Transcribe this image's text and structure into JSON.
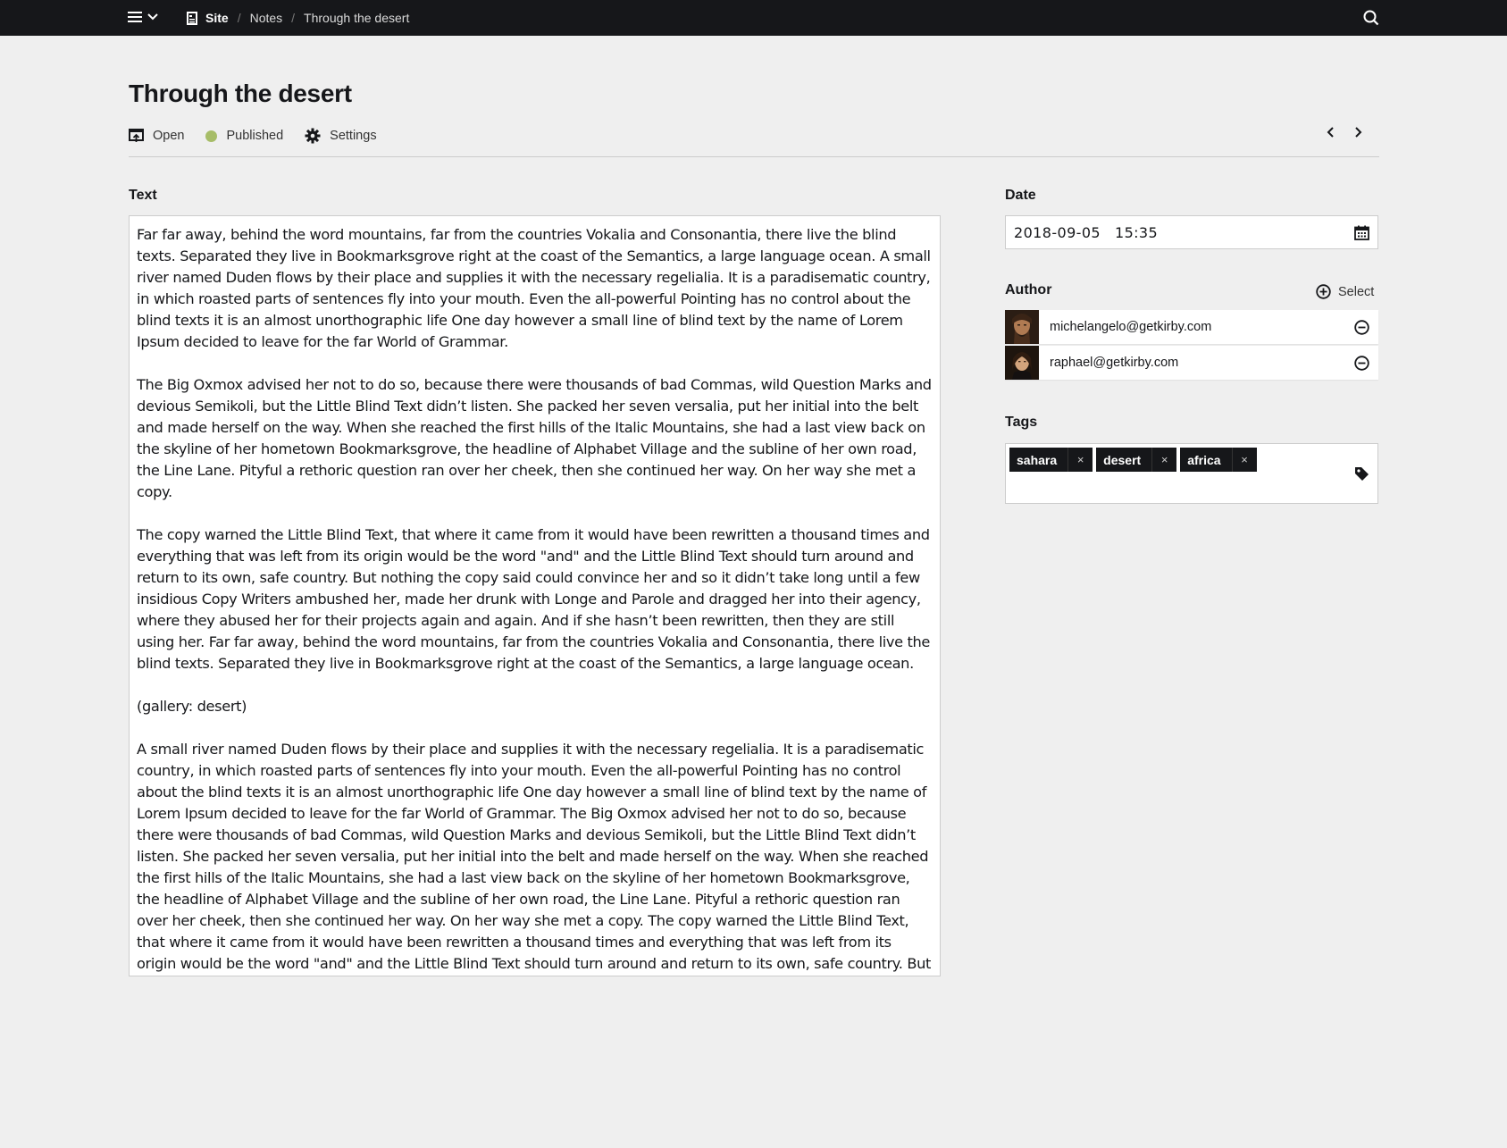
{
  "topbar": {
    "breadcrumb": {
      "site": "Site",
      "items": [
        "Notes",
        "Through the desert"
      ]
    },
    "colors": {
      "background": "#16171a"
    },
    "icons": [
      "hamburger-menu-icon",
      "chevron-down-icon",
      "page-icon",
      "search-icon"
    ]
  },
  "header": {
    "title": "Through the desert",
    "options": {
      "open": "Open",
      "status": "Published",
      "settings": "Settings"
    },
    "status_color": "#a7bd68"
  },
  "fields": {
    "text": {
      "label": "Text",
      "value": "Far far away, behind the word mountains, far from the countries Vokalia and Consonantia, there live the blind texts. Separated they live in Bookmarksgrove right at the coast of the Semantics, a large language ocean. A small river named Duden flows by their place and supplies it with the necessary regelialia. It is a paradisematic country, in which roasted parts of sentences fly into your mouth. Even the all-powerful Pointing has no control about the blind texts it is an almost unorthographic life One day however a small line of blind text by the name of Lorem Ipsum decided to leave for the far World of Grammar.\n\nThe Big Oxmox advised her not to do so, because there were thousands of bad Commas, wild Question Marks and devious Semikoli, but the Little Blind Text didn’t listen. She packed her seven versalia, put her initial into the belt and made herself on the way. When she reached the first hills of the Italic Mountains, she had a last view back on the skyline of her hometown Bookmarksgrove, the headline of Alphabet Village and the subline of her own road, the Line Lane. Pityful a rethoric question ran over her cheek, then she continued her way. On her way she met a copy.\n\nThe copy warned the Little Blind Text, that where it came from it would have been rewritten a thousand times and everything that was left from its origin would be the word \"and\" and the Little Blind Text should turn around and return to its own, safe country. But nothing the copy said could convince her and so it didn’t take long until a few insidious Copy Writers ambushed her, made her drunk with Longe and Parole and dragged her into their agency, where they abused her for their projects again and again. And if she hasn’t been rewritten, then they are still using her. Far far away, behind the word mountains, far from the countries Vokalia and Consonantia, there live the blind texts. Separated they live in Bookmarksgrove right at the coast of the Semantics, a large language ocean.\n\n(gallery: desert)\n\nA small river named Duden flows by their place and supplies it with the necessary regelialia. It is a paradisematic country, in which roasted parts of sentences fly into your mouth. Even the all-powerful Pointing has no control about the blind texts it is an almost unorthographic life One day however a small line of blind text by the name of Lorem Ipsum decided to leave for the far World of Grammar. The Big Oxmox advised her not to do so, because there were thousands of bad Commas, wild Question Marks and devious Semikoli, but the Little Blind Text didn’t listen. She packed her seven versalia, put her initial into the belt and made herself on the way. When she reached the first hills of the Italic Mountains, she had a last view back on the skyline of her hometown Bookmarksgrove, the headline of Alphabet Village and the subline of her own road, the Line Lane. Pityful a rethoric question ran over her cheek, then she continued her way. On her way she met a copy. The copy warned the Little Blind Text, that where it came from it would have been rewritten a thousand times and everything that was left from its origin would be the word \"and\" and the Little Blind Text should turn around and return to its own, safe country. But nothing the copy said could convince her and so it didn’t take long until a few insidious Copy Writers ambushed her, made her drunk"
    },
    "date": {
      "label": "Date",
      "date": "2018-09-05",
      "time": "15:35"
    },
    "author": {
      "label": "Author",
      "select_label": "Select",
      "users": [
        {
          "email": "michelangelo@getkirby.com",
          "avatar_color": "#5a3a26"
        },
        {
          "email": "raphael@getkirby.com",
          "avatar_color": "#3d2a1c"
        }
      ]
    },
    "tags": {
      "label": "Tags",
      "items": [
        "sahara",
        "desert",
        "africa"
      ],
      "remove_glyph": "×"
    }
  }
}
